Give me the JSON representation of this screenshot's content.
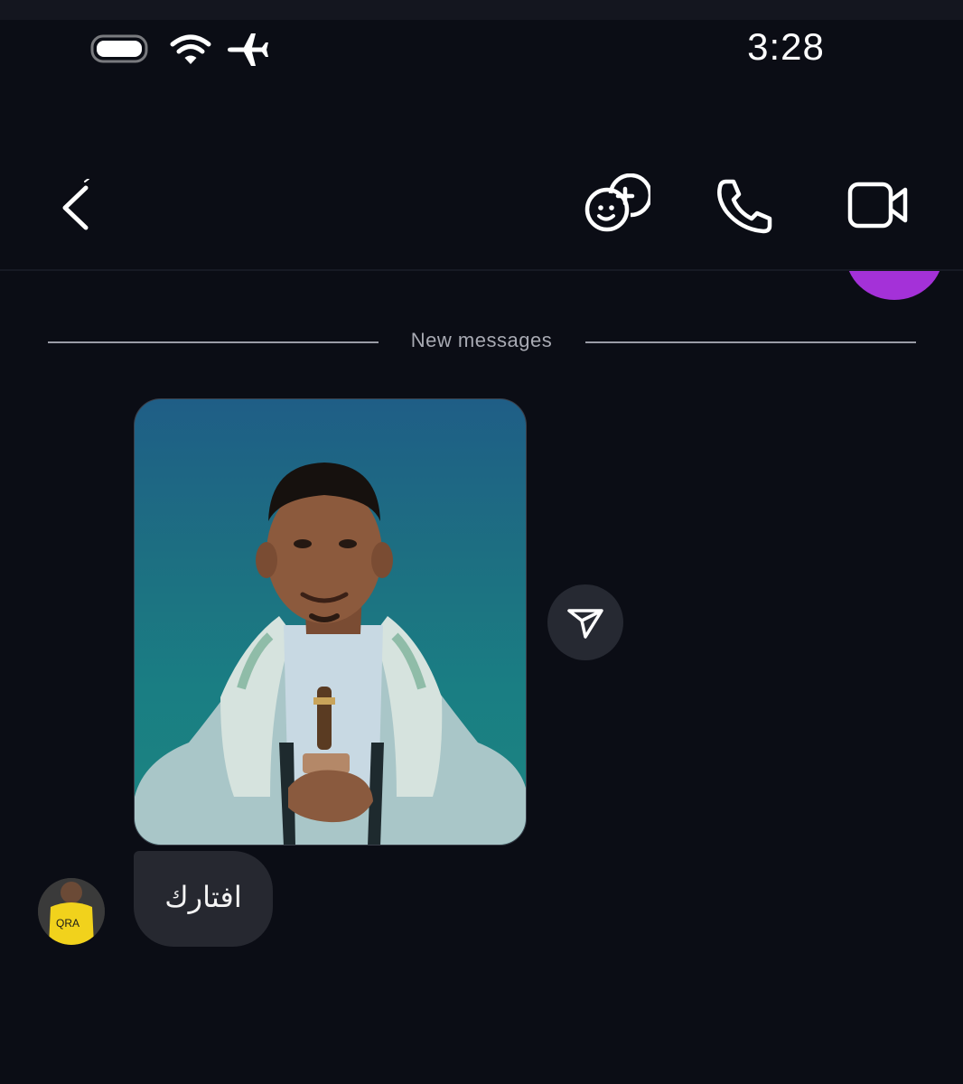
{
  "status_bar": {
    "time": "3:28",
    "icons": [
      "battery-icon",
      "wifi-icon",
      "airplane-mode-icon"
    ]
  },
  "header": {
    "back_icon": "chevron-left-icon",
    "actions": [
      "effects-icon",
      "phone-icon",
      "video-camera-icon"
    ]
  },
  "divider": {
    "label": "New messages"
  },
  "messages": [
    {
      "type": "photo",
      "icon": "send-icon"
    },
    {
      "type": "text",
      "text": "افتارك"
    }
  ],
  "colors": {
    "background": "#0b0d15",
    "bubble": "#262830",
    "accent_purple": "#a431d8",
    "divider": "#9a9ca6"
  }
}
